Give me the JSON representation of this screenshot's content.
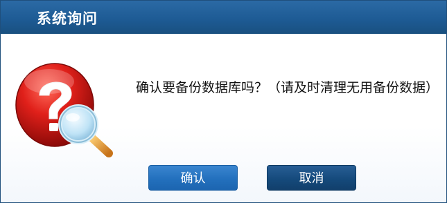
{
  "window": {
    "title": "系统询问"
  },
  "dialog": {
    "message": "确认要备份数据库吗？（请及时清理无用备份数据）",
    "icon": "question-magnifier-icon"
  },
  "buttons": {
    "ok_label": "确认",
    "cancel_label": "取消"
  },
  "colors": {
    "titlebar": "#1d5a93",
    "ok_button": "#2370bd",
    "cancel_button": "#154a7c"
  }
}
